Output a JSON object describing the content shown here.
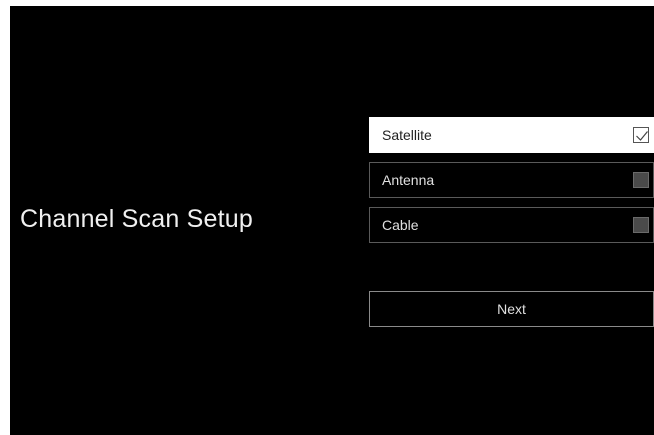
{
  "screen": {
    "title": "Channel Scan Setup"
  },
  "options": [
    {
      "label": "Satellite",
      "checked": true,
      "icon": "checkbox-checked-icon"
    },
    {
      "label": "Antenna",
      "checked": false,
      "icon": "checkbox-icon"
    },
    {
      "label": "Cable",
      "checked": false,
      "icon": "checkbox-icon"
    }
  ],
  "next_button": {
    "label": "Next"
  },
  "colors": {
    "background": "#000000",
    "selected_background": "#ffffff",
    "text": "#e0e0e0",
    "selected_text": "#222222"
  }
}
